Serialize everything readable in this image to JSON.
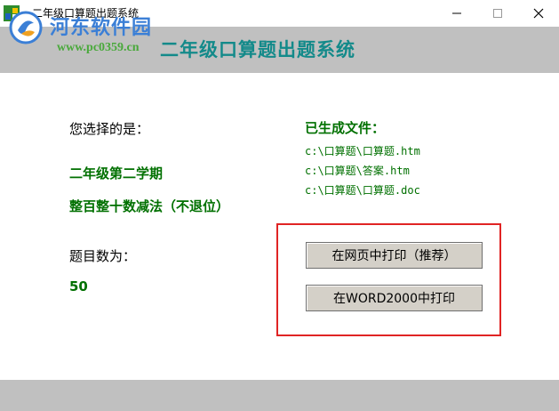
{
  "window": {
    "title": "二年级口算题出题系统",
    "minimize_glyph": "—",
    "maximize_glyph": "☐",
    "close_glyph": "✕"
  },
  "watermark": {
    "name": "河东软件园",
    "url": "www.pc0359.cn"
  },
  "banner": {
    "title": "二年级口算题出题系统"
  },
  "selection": {
    "label": "您选择的是：",
    "grade": "二年级第二学期",
    "exercise_type": "整百整十数减法（不退位）",
    "count_label": "题目数为：",
    "count_value": "50"
  },
  "files": {
    "label": "已生成文件：",
    "items": [
      "c:\\口算题\\口算题.htm",
      "c:\\口算题\\答案.htm",
      "c:\\口算题\\口算题.doc"
    ]
  },
  "actions": {
    "print_web_label": "在网页中打印（推荐）",
    "print_word_label": "在WORD2000中打印"
  },
  "colors": {
    "green_text": "#007000",
    "banner_teal": "#138a8a",
    "highlight_red": "#e02424",
    "band_gray": "#c0c0c0",
    "watermark_blue": "#3b7fd6",
    "watermark_green": "#49a93b"
  },
  "icons": {
    "app": "app-icon",
    "watermark_logo": "watermark-logo-icon"
  }
}
